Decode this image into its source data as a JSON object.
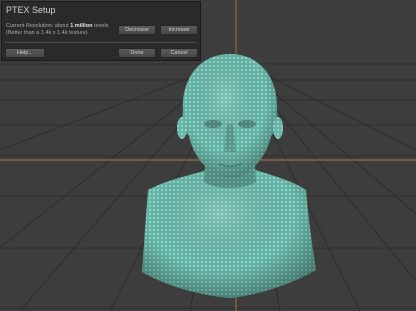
{
  "dialog": {
    "title": "PTEX Setup",
    "resolution_prefix": "Current Resolution: about ",
    "resolution_value": "1 million",
    "resolution_suffix": " texels",
    "resolution_note": "(Better than a 1.4k x 1.4k texture)",
    "decrease_label": "Decrease",
    "increase_label": "Increase",
    "help_label": "Help...",
    "done_label": "Done",
    "cancel_label": "Cancel"
  },
  "viewport": {
    "model": "head-bust",
    "colors": {
      "background": "#3d3d3d",
      "grid_line": "#2a2a2a",
      "grid_axis": "#b07a3a",
      "mesh": "#5fb8a8",
      "mesh_dots": "#d8d8d8",
      "dialog_background": "#2a2a2a"
    }
  }
}
